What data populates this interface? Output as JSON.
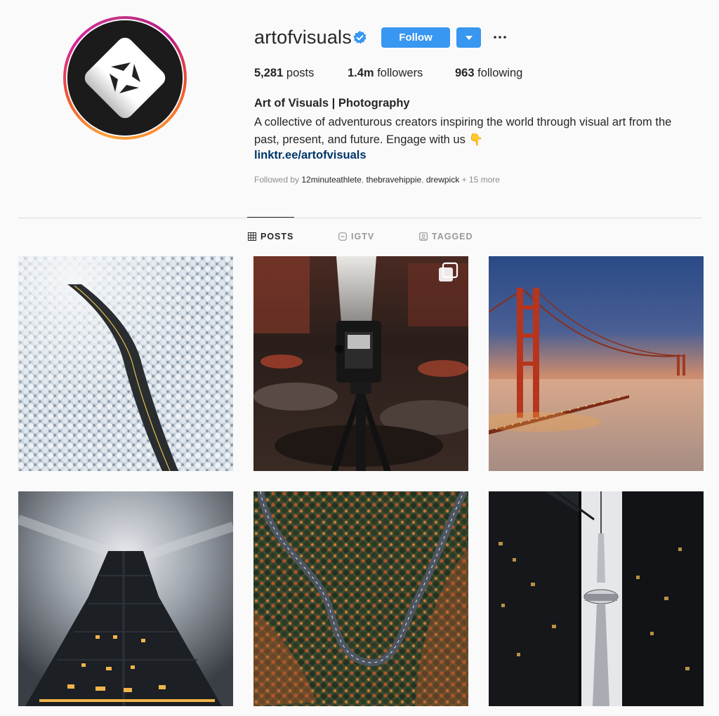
{
  "profile": {
    "username": "artofvisuals",
    "follow_label": "Follow",
    "stats": {
      "posts_count": "5,281",
      "posts_label": "posts",
      "followers_count": "1.4m",
      "followers_label": "followers",
      "following_count": "963",
      "following_label": "following"
    },
    "full_name": "Art of Visuals | Photography",
    "bio_line1": "A collective of adventurous creators inspiring the world through visual art from the",
    "bio_line2": "past, present, and future. Engage with us 👇",
    "link": "linktr.ee/artofvisuals",
    "followed_by_prefix": "Followed by",
    "followed_by_users": [
      "12minuteathlete",
      "thebravehippie",
      "drewpick"
    ],
    "followed_by_more": "+ 15 more"
  },
  "tabs": [
    {
      "label": "POSTS",
      "icon": "grid-icon",
      "active": true
    },
    {
      "label": "IGTV",
      "icon": "igtv-icon",
      "active": false
    },
    {
      "label": "TAGGED",
      "icon": "tagged-icon",
      "active": false
    }
  ],
  "posts": [
    {
      "subject": "frosted forest road aerial"
    },
    {
      "subject": "camera on tripod by waterfall",
      "multiple": true
    },
    {
      "subject": "golden gate bridge in fog at sunset"
    },
    {
      "subject": "dark skyscraper long exposure"
    },
    {
      "subject": "winding road through autumn forest"
    },
    {
      "subject": "cn tower between skyscrapers"
    }
  ],
  "colors": {
    "accent": "#3897f0",
    "link": "#003569",
    "muted": "#8e8e8e",
    "text": "#262626"
  }
}
